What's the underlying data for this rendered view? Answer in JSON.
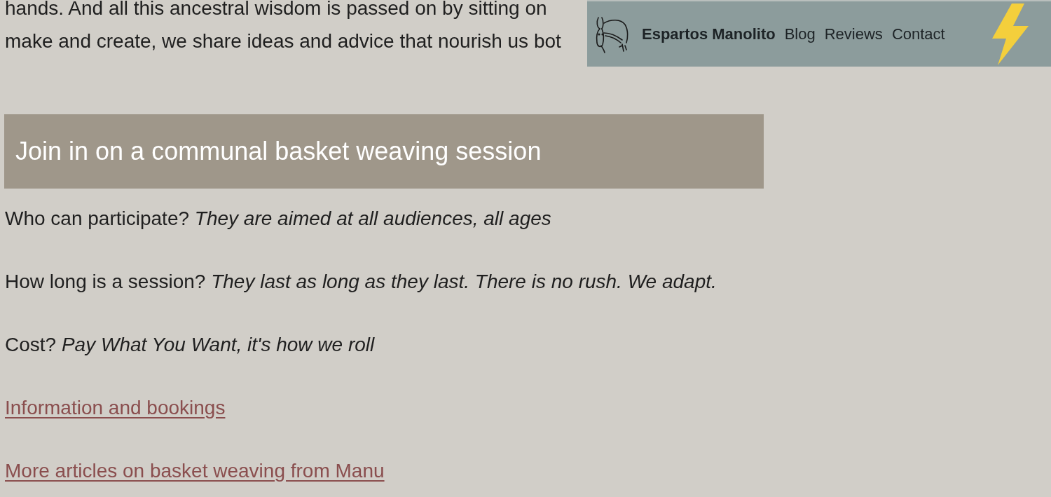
{
  "intro_lines": [
    "hands. And all this ancestral wisdom is passed on by sitting on",
    "make and create, we share ideas and advice that nourish us bot"
  ],
  "nav": {
    "brand": "Espartos Manolito",
    "links": [
      "Blog",
      "Reviews",
      "Contact"
    ]
  },
  "heading": "Join in on a communal basket weaving session",
  "faq": [
    "Who can participate? *They are aimed at all audiences, all ages*",
    "How long is a session? *They last as long as they last. There is no rush. We adapt.*",
    "Cost? *Pay What You Want, it's how we roll*"
  ],
  "links": [
    "Information and bookings",
    "More articles on basket weaving from Manu"
  ]
}
